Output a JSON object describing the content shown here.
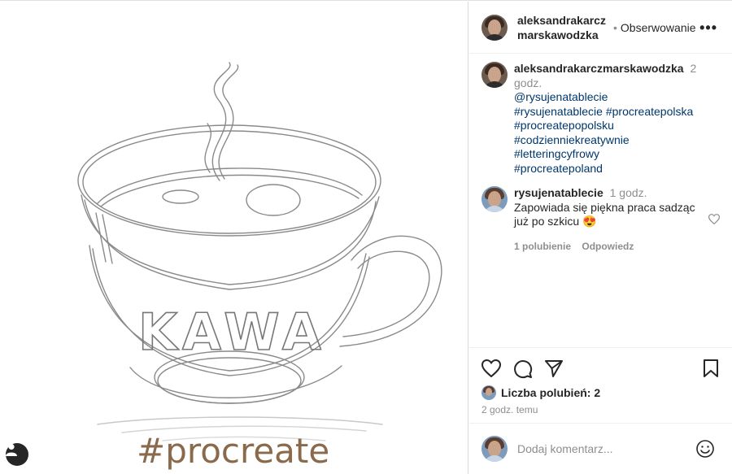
{
  "post": {
    "image_text": "#procreate",
    "cup_lettering": "KAWA"
  },
  "header": {
    "username": "aleksandrakarczmarskawodzka",
    "follow_dot": "•",
    "follow_label": "Obserwowanie",
    "more_label": "•••"
  },
  "caption": {
    "author": "aleksandrakarczmarskawodzka",
    "time": "2 godz.",
    "lines": [
      "@rysujenatablecie",
      "#rysujenatablecie #procreatepolska",
      "#procreatepopolsku",
      "#codzienniekreatywnie #letteringcyfrowy",
      "#procreatepoland"
    ]
  },
  "comment": {
    "author": "rysujenatablecie",
    "time": "1 godz.",
    "text": "Zapowiada się piękna praca sadząc już po szkicu 😍",
    "likes_label": "1 polubienie",
    "reply_label": "Odpowiedz"
  },
  "likes": {
    "label": "Liczba polubień: 2"
  },
  "post_time": "2 godz. temu",
  "add_comment": {
    "placeholder": "Dodaj komentarz..."
  },
  "colors": {
    "link": "#00376b",
    "muted": "#8e8e8e",
    "text": "#262626",
    "brand_text": "#8a6a4a"
  }
}
